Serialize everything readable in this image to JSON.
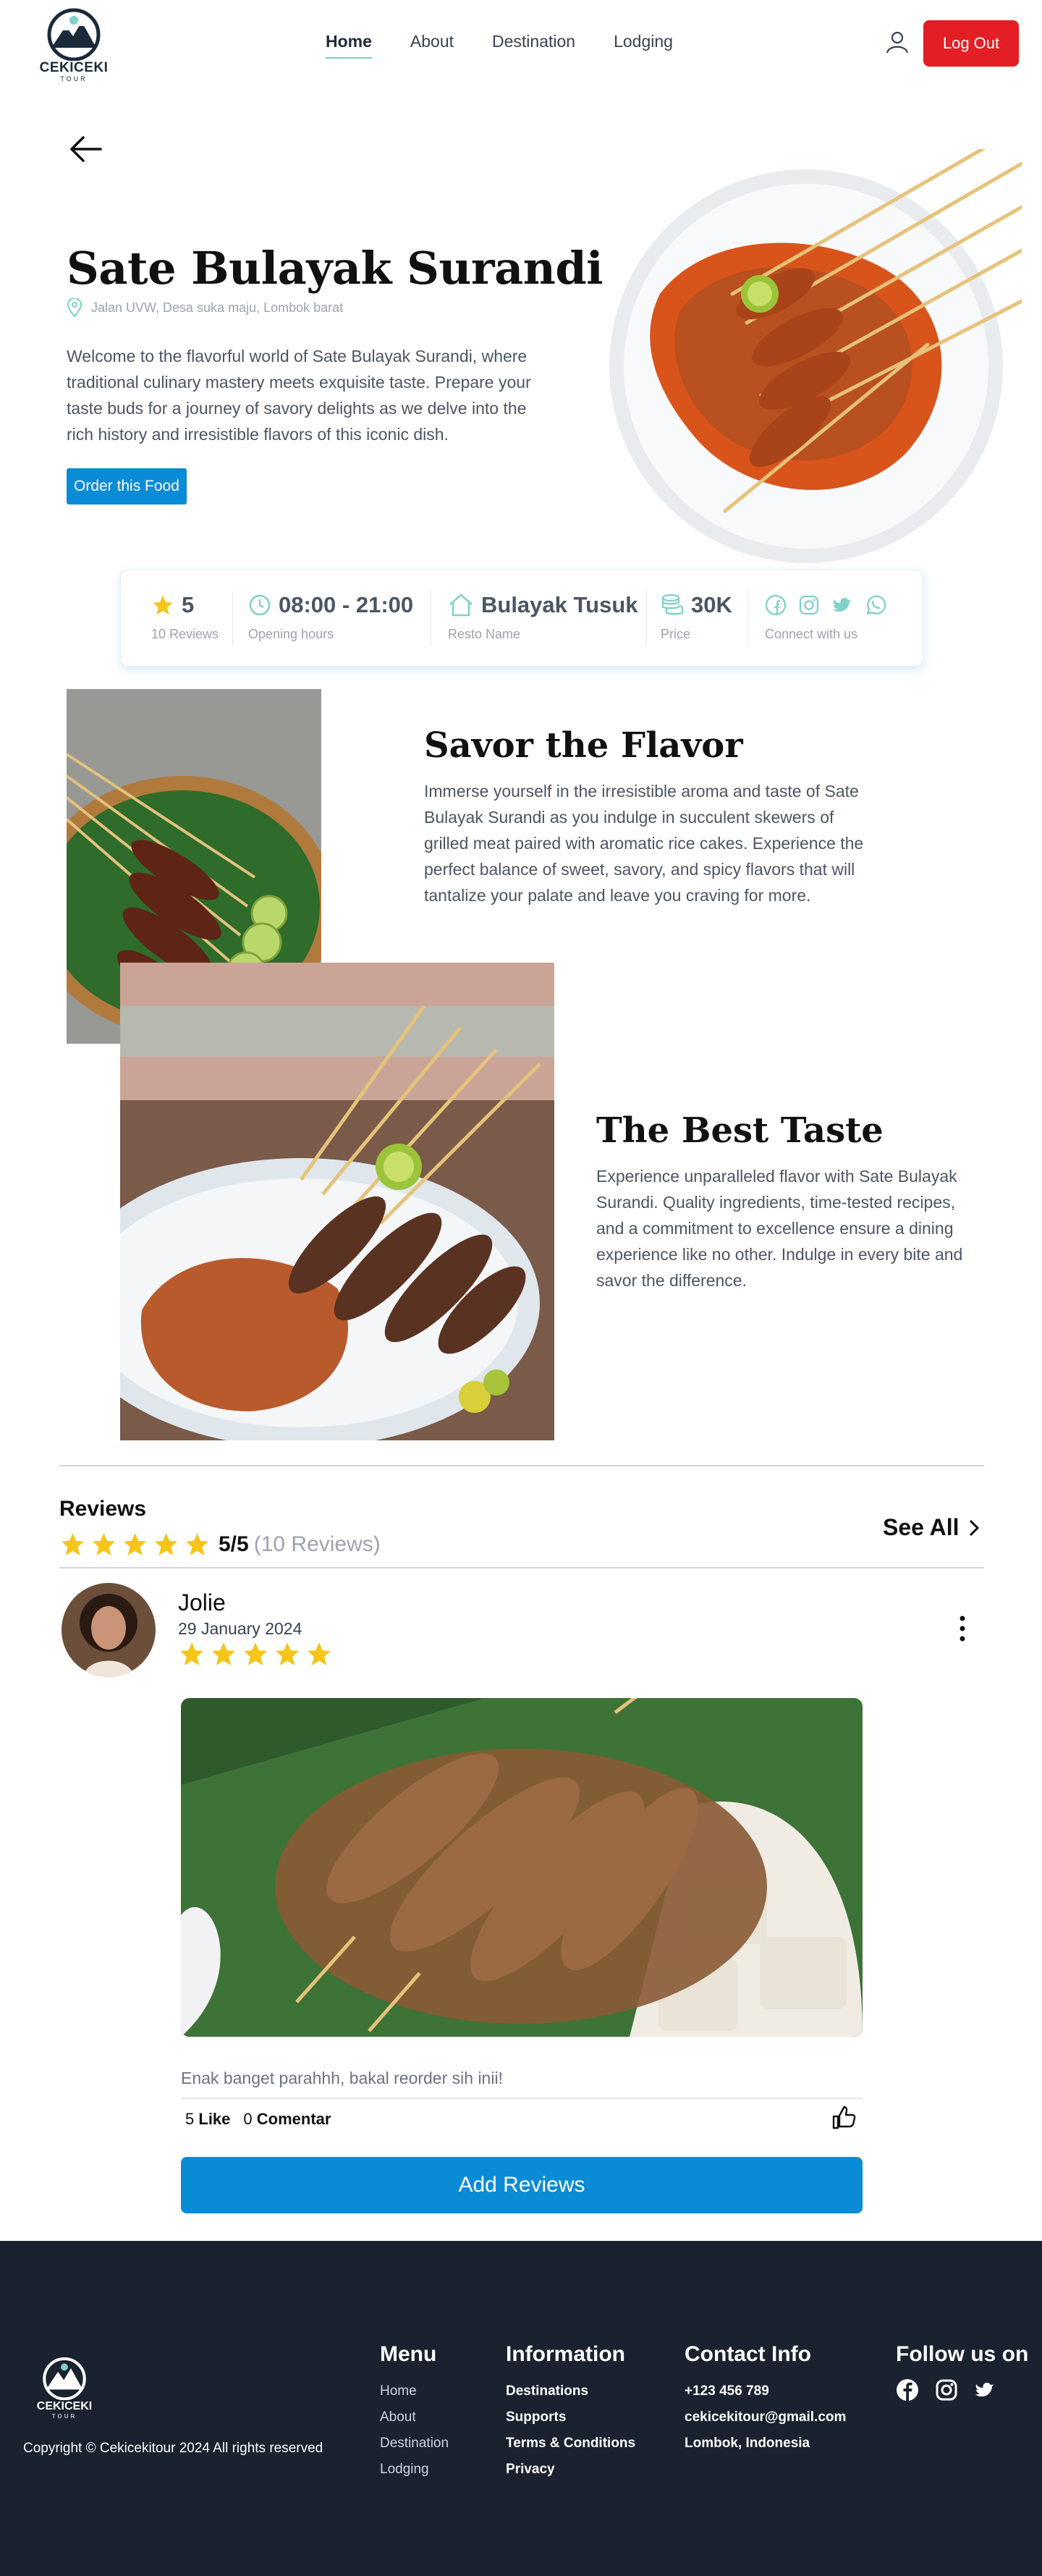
{
  "nav": {
    "logo_word": "CEKICEKI",
    "logo_sub": "TOUR",
    "links": [
      "Home",
      "About",
      "Destination",
      "Lodging"
    ],
    "active": "Home",
    "logout_label": "Log Out"
  },
  "hero": {
    "title": "Sate Bulayak Surandi",
    "address": "Jalan UVW, Desa suka maju, Lombok barat",
    "description": "Welcome to the flavorful world of Sate Bulayak Surandi, where traditional culinary mastery meets exquisite taste. Prepare your taste buds for a journey of savory delights as we delve into the rich history and irresistible flavors of this iconic dish.",
    "order_label": "Order this Food"
  },
  "info": {
    "rating": "5",
    "rating_label": "10 Reviews",
    "hours": "08:00 - 21:00",
    "hours_label": "Opening hours",
    "resto": "Bulayak Tusuk",
    "resto_label": "Resto Name",
    "price": "30K",
    "price_label": "Price",
    "connect_label": "Connect with us",
    "socials": [
      "facebook-icon",
      "instagram-icon",
      "twitter-icon",
      "whatsapp-icon"
    ]
  },
  "savor": {
    "title": "Savor the Flavor",
    "description": "Immerse yourself in the irresistible aroma and taste of Sate Bulayak Surandi as you indulge in succulent skewers of grilled meat paired with aromatic rice cakes. Experience the perfect balance of sweet, savory, and spicy flavors that will tantalize your palate and leave you craving for more."
  },
  "best": {
    "title": "The Best Taste",
    "description": "Experience unparalleled flavor with Sate Bulayak Surandi. Quality ingredients, time-tested recipes, and a commitment to excellence ensure a dining experience like no other. Indulge in every bite and savor the difference."
  },
  "reviews": {
    "heading": "Reviews",
    "score": "5/5",
    "count": "(10 Reviews)",
    "stars": 5,
    "see_all": "See All",
    "items": [
      {
        "name": "Jolie",
        "date": "29 January 2024",
        "stars": 5,
        "text": "Enak banget parahhh, bakal reorder sih inii!",
        "likes": "5",
        "like_label": "Like",
        "comments": "0",
        "comment_label": "Comentar"
      }
    ],
    "add_label": "Add Reviews"
  },
  "footer": {
    "logo_word": "CEKICEKI",
    "logo_sub": "TOUR",
    "copyright": "Copyright © Cekicekitour 2024 All rights reserved",
    "menu_title": "Menu",
    "menu": [
      "Home",
      "About",
      "Destination",
      "Lodging"
    ],
    "info_title": "Information",
    "info": [
      "Destinations",
      "Supports",
      "Terms & Conditions",
      "Privacy"
    ],
    "contact_title": "Contact Info",
    "contact": [
      "+123 456 789",
      "cekicekitour@gmail.com",
      "Lombok, Indonesia"
    ],
    "follow_title": "Follow us on",
    "follow": [
      "facebook-icon",
      "instagram-icon",
      "twitter-icon"
    ]
  },
  "colors": {
    "accent": "#0a8bd6",
    "logout": "#e31e24",
    "star": "#f5c518",
    "footer_bg": "#19222e",
    "teal": "#7fd1c9"
  }
}
